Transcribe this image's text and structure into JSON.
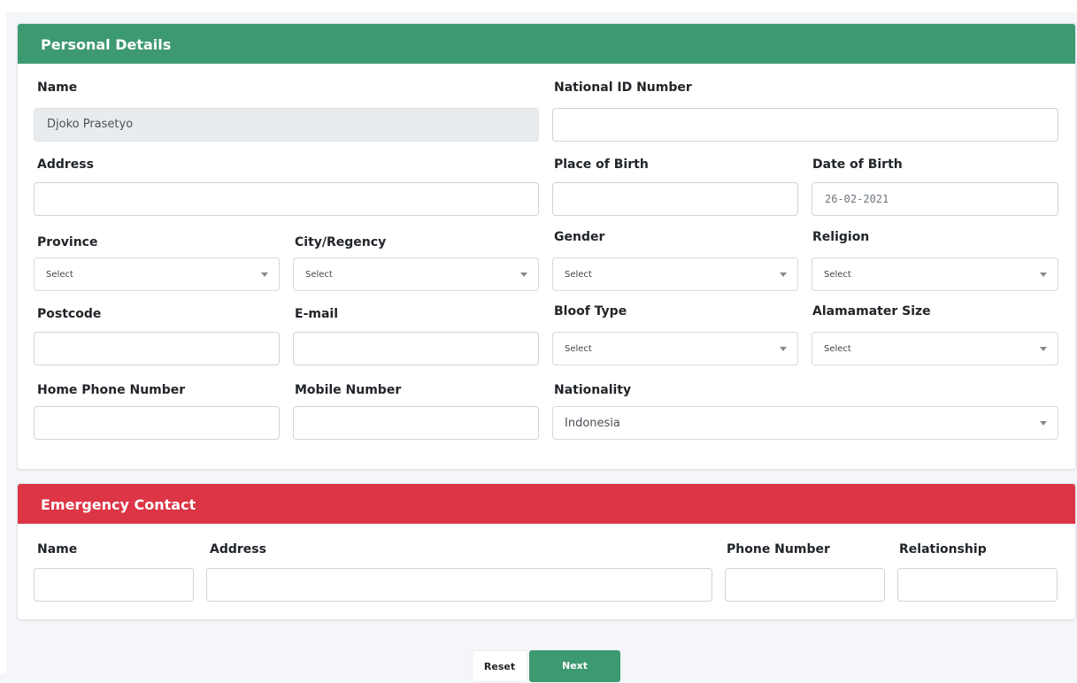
{
  "personal": {
    "header": "Personal Details",
    "labels": {
      "name": "Name",
      "national_id": "National ID Number",
      "address": "Address",
      "place_of_birth": "Place of Birth",
      "date_of_birth": "Date of Birth",
      "province": "Province",
      "city": "City/Regency",
      "gender": "Gender",
      "religion": "Religion",
      "postcode": "Postcode",
      "email": "E-mail",
      "blood_type": "Bloof Type",
      "alma_size": "Alamamater Size",
      "home_phone": "Home Phone Number",
      "mobile": "Mobile Number",
      "nationality": "Nationality"
    },
    "values": {
      "name": "Djoko Prasetyo",
      "date_of_birth": "26-02-2021",
      "nationality": "Indonesia"
    },
    "select_placeholder": "Select"
  },
  "emergency": {
    "header": "Emergency Contact",
    "labels": {
      "name": "Name",
      "address": "Address",
      "phone": "Phone Number",
      "relationship": "Relationship"
    }
  },
  "actions": {
    "reset": "Reset",
    "next": "Next"
  },
  "colors": {
    "personal_header": "#3d9970",
    "emergency_header": "#dc3545",
    "next_button": "#3d9970"
  },
  "icons": {
    "dropdown": "caret-down-icon"
  }
}
